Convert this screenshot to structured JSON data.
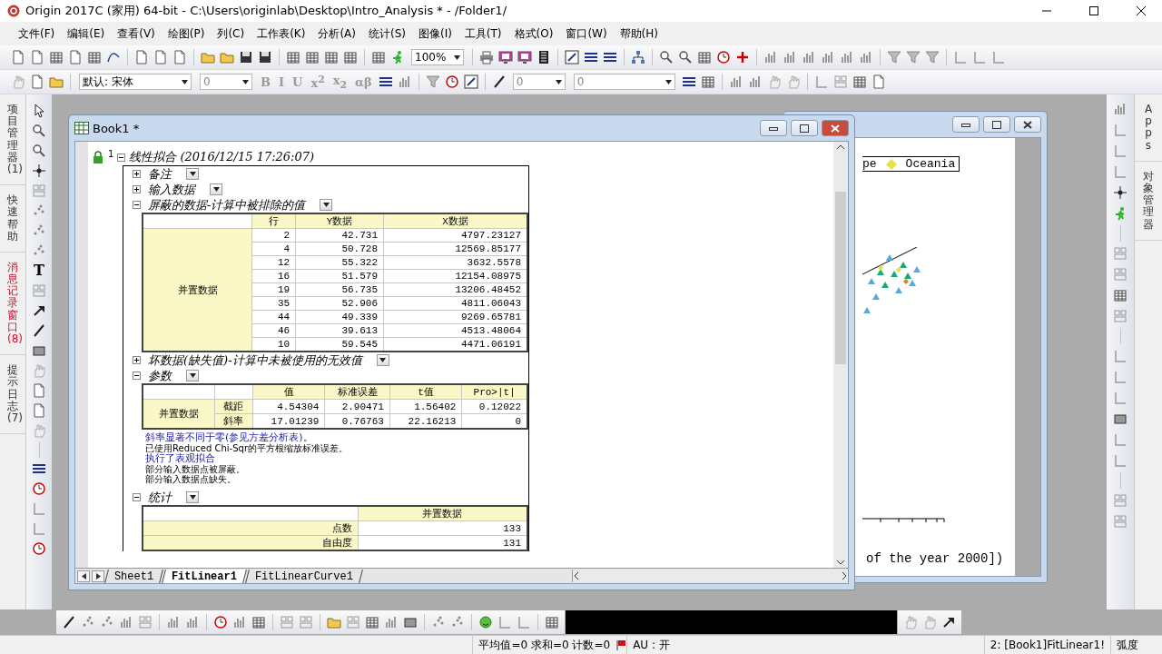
{
  "window": {
    "title": "Origin 2017C (家用) 64-bit - C:\\Users\\originlab\\Desktop\\Intro_Analysis * - /Folder1/"
  },
  "menu": [
    "文件(F)",
    "编辑(E)",
    "查看(V)",
    "绘图(P)",
    "列(C)",
    "工作表(K)",
    "分析(A)",
    "统计(S)",
    "图像(I)",
    "工具(T)",
    "格式(O)",
    "窗口(W)",
    "帮助(H)"
  ],
  "toolbar": {
    "zoom": "100%"
  },
  "format_bar": {
    "font": "默认: 宋体",
    "size": "0",
    "buttons": [
      "B",
      "I",
      "U",
      "x$^{2}$",
      "x$_{2}$",
      "αβ"
    ],
    "fields": [
      "0",
      "0"
    ]
  },
  "left_tabs": [
    {
      "label": "项目管理器 (1)",
      "alert": false
    },
    {
      "label": "快速帮助",
      "alert": false
    },
    {
      "label": "消息记录窗口 (8)",
      "alert": true
    },
    {
      "label": "提示日志 (7)",
      "alert": false
    }
  ],
  "tools": {
    "text_tool": "T"
  },
  "right_tabs": [
    {
      "label": "Apps"
    },
    {
      "label": "对象管理器"
    }
  ],
  "book": {
    "title": "Book1 *",
    "report": {
      "index": "1",
      "title": "线性拟合 (2016/12/15 17:26:07)",
      "expanded": true,
      "sections": [
        {
          "kind": "folded",
          "title": "备注",
          "expanded": false
        },
        {
          "kind": "folded",
          "title": "输入数据",
          "expanded": false
        },
        {
          "kind": "masked_table",
          "title": "屏蔽的数据-计算中被排除的值",
          "expanded": true,
          "table": {
            "columns": [
              "行",
              "Y数据",
              "X数据"
            ],
            "group": "并置数据",
            "rows": [
              [
                "2",
                "42.731",
                "4797.23127"
              ],
              [
                "4",
                "50.728",
                "12569.85177"
              ],
              [
                "12",
                "55.322",
                "3632.5578"
              ],
              [
                "16",
                "51.579",
                "12154.08975"
              ],
              [
                "19",
                "56.735",
                "13206.48452"
              ],
              [
                "35",
                "52.906",
                "4811.06043"
              ],
              [
                "44",
                "49.339",
                "9269.65781"
              ],
              [
                "46",
                "39.613",
                "4513.48064"
              ],
              [
                "10",
                "59.545",
                "4471.06191"
              ]
            ]
          }
        },
        {
          "kind": "folded",
          "title": "坏数据(缺失值)-计算中未被使用的无效值",
          "expanded": false
        },
        {
          "kind": "param_table",
          "title": "参数",
          "expanded": true,
          "table": {
            "columns": [
              "值",
              "标准误差",
              "t值",
              "Pro>|t|"
            ],
            "group": "并置数据",
            "rows": [
              {
                "label": "截距",
                "values": [
                  "4.54304",
                  "2.90471",
                  "1.56402",
                  "0.12022"
                ]
              },
              {
                "label": "斜率",
                "values": [
                  "17.01239",
                  "0.76763",
                  "22.16213",
                  "0"
                ]
              }
            ]
          },
          "notes": [
            {
              "text": "斜率显著不同于零(参见方差分析表)。",
              "emphasis": true
            },
            {
              "text": "已使用Reduced Chi-Sqr的平方根缩放标准误差。",
              "emphasis": false
            },
            {
              "text": "执行了表观拟合",
              "emphasis": true
            },
            {
              "text": "部分输入数据点被屏蔽。",
              "emphasis": false
            },
            {
              "text": "部分输入数据点缺失。",
              "emphasis": false
            }
          ]
        },
        {
          "kind": "stats_table",
          "title": "统计",
          "expanded": true,
          "table": {
            "columns": [
              "并置数据"
            ],
            "rows": [
              {
                "label": "点数",
                "values": [
                  "133"
                ]
              },
              {
                "label": "自由度",
                "values": [
                  "131"
                ]
              }
            ]
          }
        }
      ]
    },
    "sheets": [
      {
        "label": "Sheet1",
        "selected": false
      },
      {
        "label": "FitLinear1",
        "selected": true
      },
      {
        "label": "FitLinearCurve1",
        "selected": false
      }
    ]
  },
  "graph": {
    "legend_cut": "pe",
    "legend": [
      {
        "label": "Oceania",
        "color": "#e6e04a"
      }
    ],
    "axis_title": "of the year 2000])"
  },
  "status_bar": {
    "stats": "平均值=0 求和=0 计数=0",
    "au": "AU : 开",
    "cell": "2: [Book1]FitLinear1!",
    "angle": "弧度"
  }
}
